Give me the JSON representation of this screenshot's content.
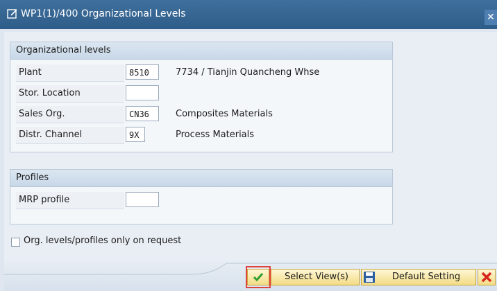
{
  "window": {
    "title": "WP1(1)/400 Organizational Levels",
    "close_glyph": "✕"
  },
  "org_levels": {
    "heading": "Organizational levels",
    "rows": [
      {
        "label": "Plant",
        "value": "8510",
        "description": "7734 / Tianjin Quancheng Whse"
      },
      {
        "label": "Stor. Location",
        "value": "",
        "description": ""
      },
      {
        "label": "Sales Org.",
        "value": "CN36",
        "description": "Composites Materials"
      },
      {
        "label": "Distr. Channel",
        "value": "9X",
        "description": "Process Materials"
      }
    ]
  },
  "profiles": {
    "heading": "Profiles",
    "rows": [
      {
        "label": "MRP profile",
        "value": ""
      }
    ]
  },
  "options": {
    "only_on_request_label": "Org. levels/profiles only on request",
    "only_on_request_checked": false
  },
  "buttons": {
    "select_views": "Select View(s)",
    "default_setting": "Default Setting"
  },
  "icons": {
    "title_icon": "edit-window-icon",
    "confirm_icon": "checkmark-icon",
    "default_icon": "save-disk-icon",
    "cancel_icon": "cancel-x-icon"
  },
  "colors": {
    "titlebar": "#2f5d8a",
    "button_gold": "#f2dc84",
    "check_green": "#2f9e2f",
    "cancel_red": "#d7261e",
    "highlight_red": "#e0443f"
  }
}
